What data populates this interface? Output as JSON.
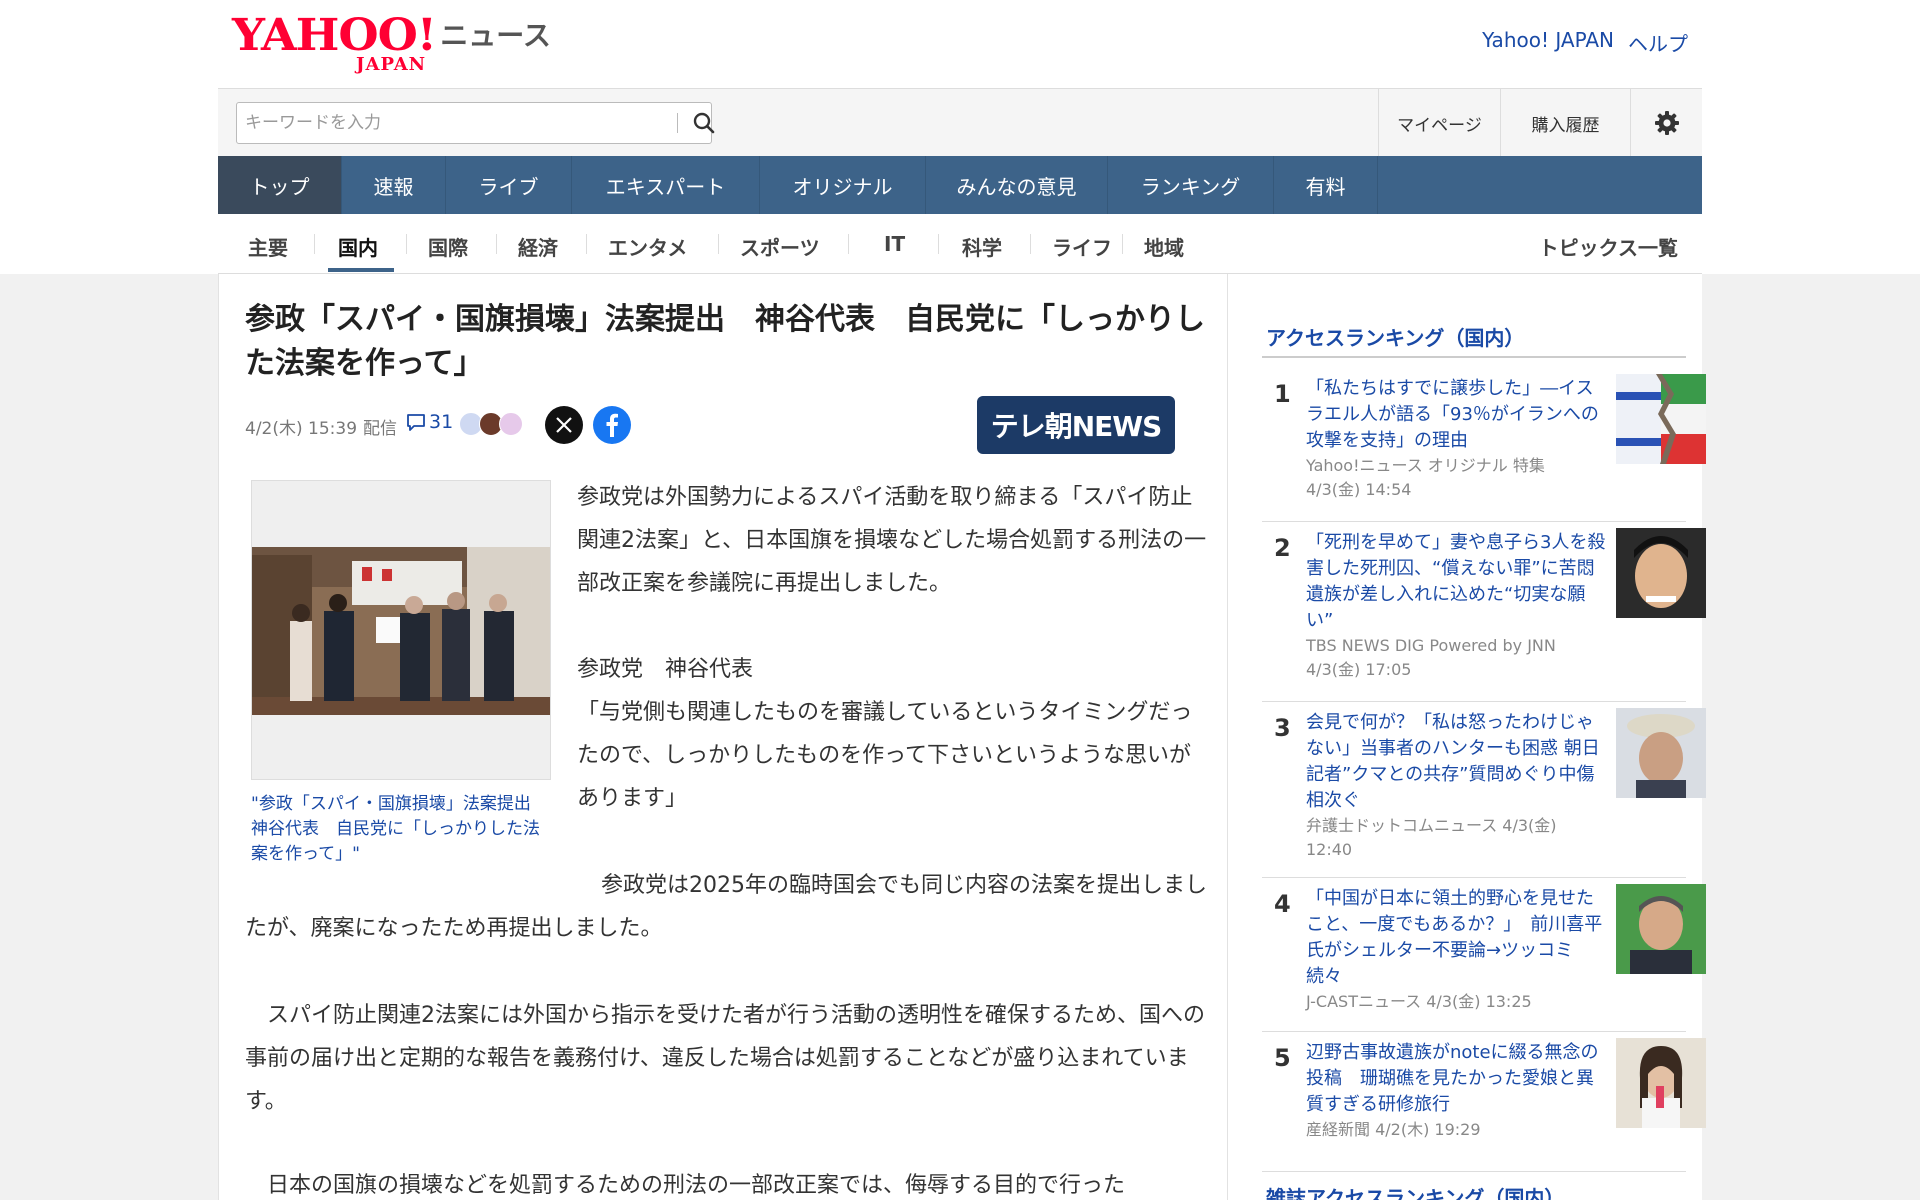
{
  "header": {
    "logo_main": "YAHOO!",
    "logo_sub": "JAPAN",
    "logo_news": "ニュース",
    "link_yahoo": "Yahoo! JAPAN",
    "link_help": "ヘルプ"
  },
  "search": {
    "placeholder": "キーワードを入力",
    "mypage": "マイページ",
    "purchase_history": "購入履歴"
  },
  "main_nav": [
    "トップ",
    "速報",
    "ライブ",
    "エキスパート",
    "オリジナル",
    "みんなの意見",
    "ランキング",
    "有料"
  ],
  "main_nav_active": "トップ",
  "sub_nav": [
    "主要",
    "国内",
    "国際",
    "経済",
    "エンタメ",
    "スポーツ",
    "IT",
    "科学",
    "ライフ",
    "地域"
  ],
  "sub_nav_active": "国内",
  "topics_link": "トピックス一覧",
  "article": {
    "title": "参政「スパイ・国旗損壊」法案提出　神谷代表　自民党に「しっかりした法案を作って」",
    "date": "4/2(木) 15:39",
    "delivered": "配信",
    "comment_count": "31",
    "media": "テレ朝NEWS",
    "photo_caption": "\"参政「スパイ・国旗損壊」法案提出　神谷代表　自民党に「しっかりした法案を作って」\"",
    "para1": "参政党は外国勢力によるスパイ活動を取り締まる「スパイ防止関連2法案」と、日本国旗を損壊などした場合処罰する刑法の一部改正案を参議院に再提出しました。",
    "speaker": "参政党　神谷代表",
    "quote": "「与党側も関連したものを審議しているというタイミングだったので、しっかりしたものを作って下さいというような思いがあります」",
    "para2": "参政党は2025年の臨時国会でも同じ内容の法案を提出しましたが、廃案になったため再提出しました。",
    "para3": "スパイ防止関連2法案には外国から指示を受けた者が行う活動の透明性を確保するため、国への事前の届け出と定期的な報告を義務付け、違反した場合は処罰することなどが盛り込まれています。",
    "para4": "日本の国旗の損壊などを処罰するための刑法の一部改正案では、侮辱する目的で行った"
  },
  "sidebar": {
    "heading": "アクセスランキング（国内）",
    "heading2": "雑誌アクセスランキング（国内）",
    "items": [
      {
        "rank": "1",
        "title": "「私たちはすでに譲歩した」―イスラエル人が語る「93％がイランへの攻撃を支持」の理由",
        "source": "Yahoo!ニュース オリジナル 特集",
        "time": "4/3(金) 14:54"
      },
      {
        "rank": "2",
        "title": "「死刑を早めて」妻や息子ら3人を殺害した死刑囚、“償えない罪”に苦悶　遺族が差し入れに込めた“切実な願い”",
        "source": "TBS NEWS DIG Powered by JNN",
        "time": "4/3(金) 17:05"
      },
      {
        "rank": "3",
        "title": "会見で何が？「私は怒ったわけじゃない」当事者のハンターも困惑 朝日記者”クマとの共存”質問めぐり中傷相次ぐ",
        "source": "弁護士ドットコムニュース 4/3(金)",
        "time": "12:40"
      },
      {
        "rank": "4",
        "title": "「中国が日本に領土的野心を見せたこと、一度でもあるか？」　前川喜平氏がシェルター不要論→ツッコミ続々",
        "source": "J-CASTニュース 4/3(金) 13:25",
        "time": ""
      },
      {
        "rank": "5",
        "title": "辺野古事故遺族がnoteに綴る無念の投稿　珊瑚礁を見たかった愛娘と異質すぎる研修旅行",
        "source": "産経新聞 4/2(木) 19:29",
        "time": ""
      }
    ]
  },
  "colors": {
    "nav_bg": "#3d6389",
    "link": "#1a4aa6",
    "logo_red": "#ff0033"
  }
}
